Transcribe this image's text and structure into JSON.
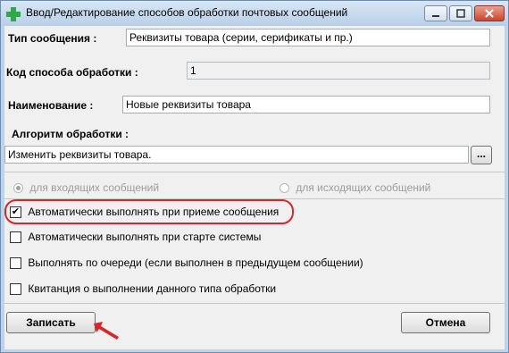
{
  "window": {
    "title": "Ввод/Редактирование способов обработки почтовых сообщений"
  },
  "form": {
    "message_type": {
      "label": "Тип сообщения :",
      "value": "Реквизиты товара (серии, серификаты и пр.)"
    },
    "method_code": {
      "label": "Код способа обработки :",
      "value": "1"
    },
    "name": {
      "label": "Наименование :",
      "value": "Новые реквизиты товара"
    },
    "algorithm": {
      "label": "Алгоритм обработки :",
      "value": "Изменить реквизиты товара.",
      "browse_label": "..."
    }
  },
  "direction": {
    "incoming_label": "для входящих сообщений",
    "outgoing_label": "для исходящих сообщений",
    "selected": "incoming"
  },
  "options": [
    {
      "label": "Автоматически выполнять при приеме сообщения",
      "checked": true,
      "check_mark": "✔"
    },
    {
      "label": "Автоматически выполнять при старте системы",
      "checked": false
    },
    {
      "label": "Выполнять по очереди (если выполнен в предыдущем сообщении)",
      "checked": false
    },
    {
      "label": "Квитанция о выполнении данного типа обработки",
      "checked": false
    }
  ],
  "buttons": {
    "save": "Записать",
    "cancel": "Отмена"
  },
  "colors": {
    "highlight": "#d9262b",
    "app_icon": "#2fa84a"
  }
}
